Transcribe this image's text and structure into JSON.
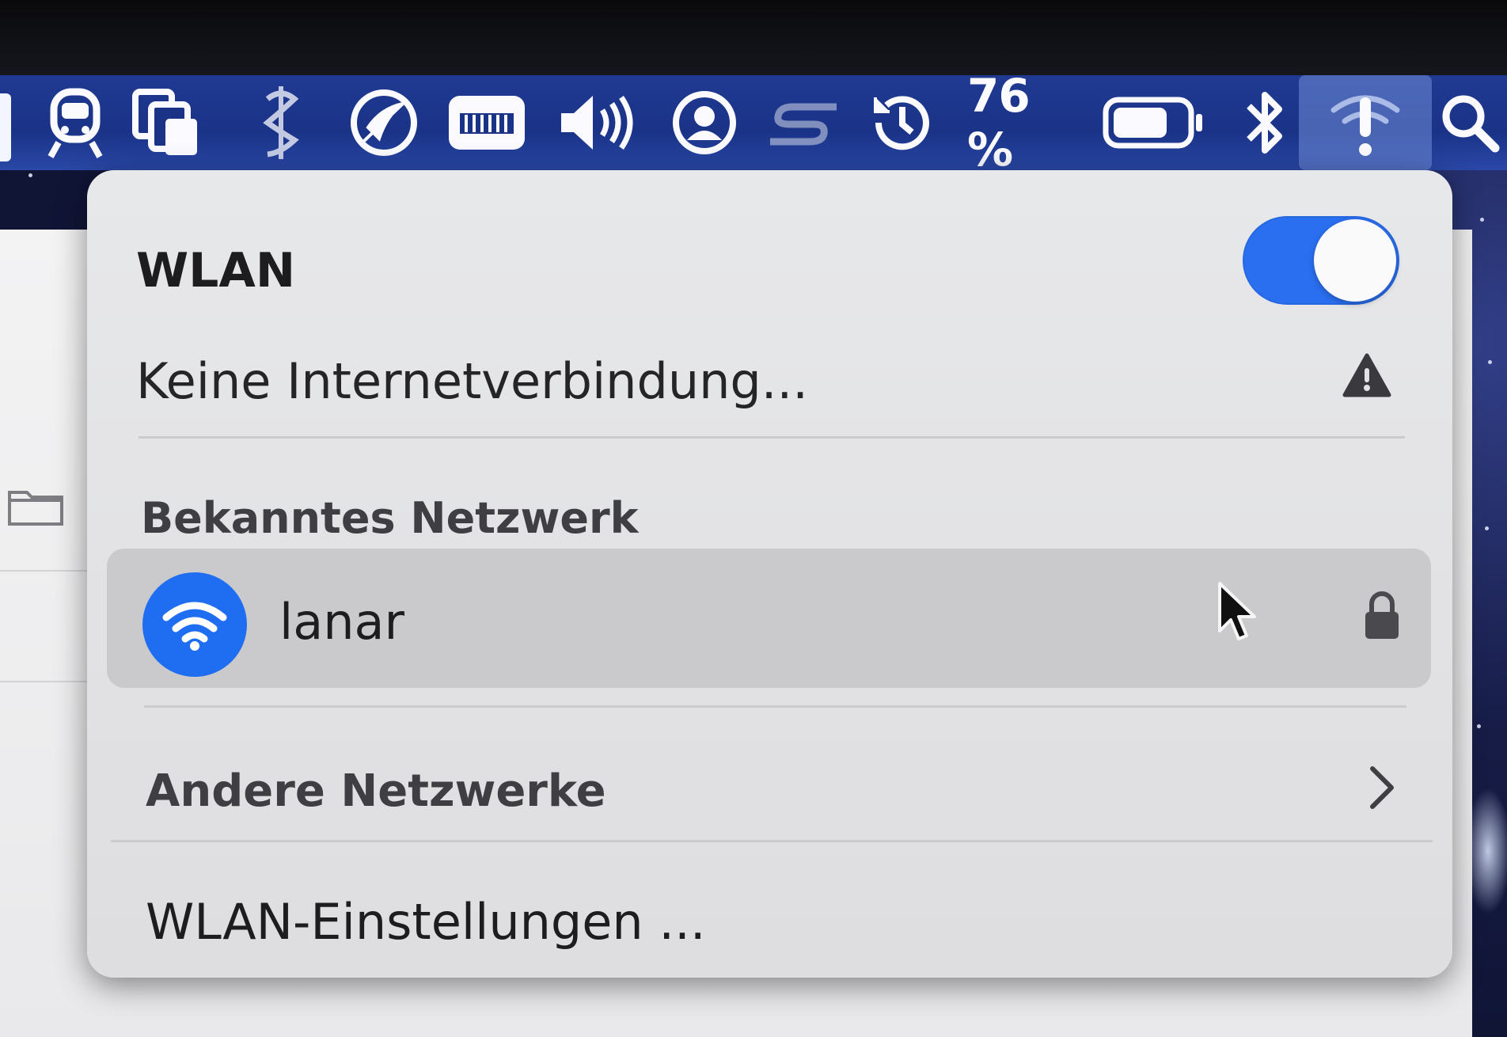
{
  "menubar": {
    "battery_percent_text": "76 %",
    "battery_level": 0.76,
    "icons": [
      "train-icon",
      "copy-icon",
      "script-icon",
      "rocket-icon",
      "keyboard-icon",
      "volume-icon",
      "user-icon",
      "s-logo-icon",
      "time-machine-icon",
      "battery-icon",
      "bluetooth-icon",
      "wifi-alert-icon",
      "search-icon"
    ],
    "colors": {
      "bar": "#1a3387",
      "active_item": "#7a98dc"
    }
  },
  "wlan_menu": {
    "title": "WLAN",
    "toggle_on": true,
    "status": "Keine Internetverbindung...",
    "known_section_label": "Bekanntes Netzwerk",
    "known_network": {
      "name": "lanar",
      "secured": true
    },
    "other_networks_label": "Andere Netzwerke",
    "settings_label": "WLAN-Einstellungen ...",
    "colors": {
      "toggle": "#2a6ff0",
      "wifi_badge": "#1f6ef2",
      "row_highlight": "#cacacd"
    }
  }
}
